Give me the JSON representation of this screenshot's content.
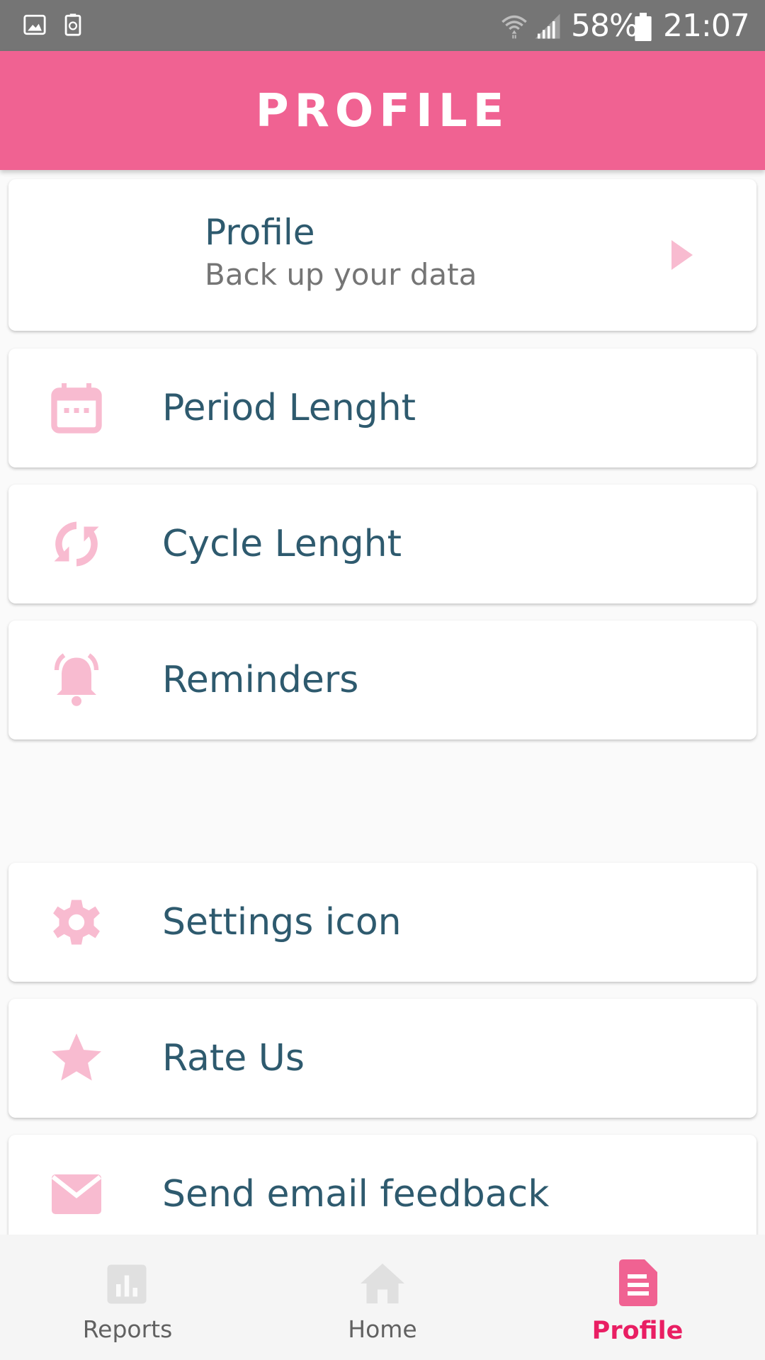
{
  "status_bar": {
    "battery": "58%",
    "time": "21:07",
    "icons": [
      "image-icon",
      "recycle-icon",
      "wifi-icon",
      "signal-icon",
      "battery-icon"
    ]
  },
  "app_bar": {
    "title": "PROFILE"
  },
  "profile_card": {
    "title": "Profile",
    "subtitle": "Back up your data",
    "icon": "chevron-right-icon"
  },
  "menu": {
    "period": {
      "label": "Period Lenght",
      "icon": "calendar-icon"
    },
    "cycle": {
      "label": "Cycle Lenght",
      "icon": "cycle-icon"
    },
    "reminders": {
      "label": "Reminders",
      "icon": "bell-icon"
    },
    "settings": {
      "label": "Settings icon",
      "icon": "gear-icon"
    },
    "rate": {
      "label": "Rate Us",
      "icon": "star-icon"
    },
    "feedback": {
      "label": "Send email feedback",
      "icon": "mail-icon"
    }
  },
  "bottom_nav": {
    "reports": {
      "label": "Reports",
      "icon": "bar-chart-icon"
    },
    "home": {
      "label": "Home",
      "icon": "home-icon"
    },
    "profile": {
      "label": "Profile",
      "icon": "document-icon",
      "active": true
    }
  },
  "colors": {
    "accent": "#f06292",
    "accent_dark": "#e91e63",
    "icon_pink": "#f8bbd0",
    "text_primary": "#2e5a6e",
    "status_bar": "#757575"
  }
}
